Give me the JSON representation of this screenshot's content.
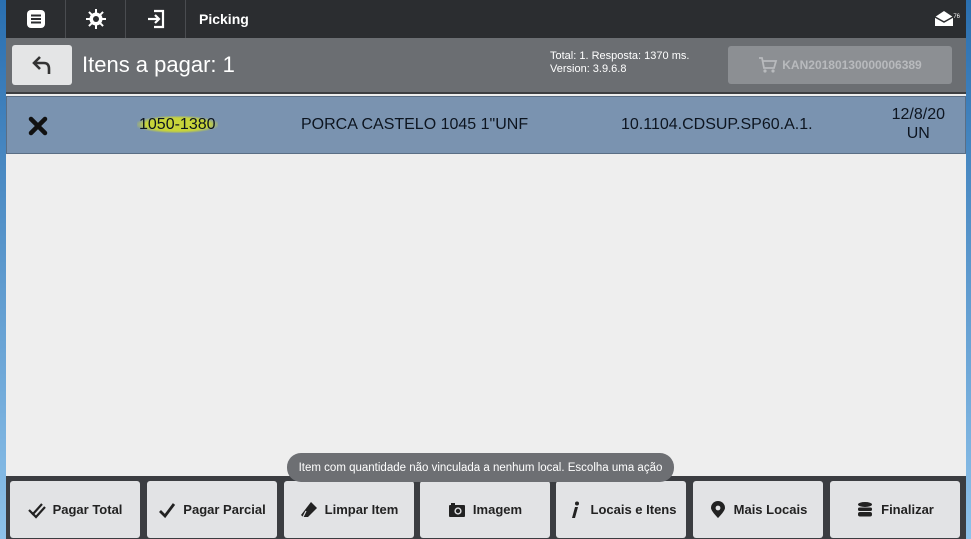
{
  "topbar": {
    "title": "Picking",
    "mail_count": "76",
    "icons": [
      "menu-icon",
      "gear-icon",
      "login-icon",
      "mail-icon"
    ]
  },
  "header": {
    "title": "Itens a pagar: 1",
    "stats_line1": "Total: 1. Resposta: 1370 ms.",
    "stats_line2": "Version: 3.9.6.8",
    "kan_label": "KAN20180130000006389"
  },
  "items": [
    {
      "code": "1050-1380",
      "description": "PORCA CASTELO 1045 1\"UNF",
      "location": "10.1104.CDSUP.SP60.A.1.",
      "quantity": "12/8/20",
      "unit": "UN"
    }
  ],
  "toast": "Item com quantidade não vinculada a nenhum local. Escolha uma ação",
  "actions": {
    "pagar_total": "Pagar Total",
    "pagar_parcial": "Pagar Parcial",
    "limpar_item": "Limpar Item",
    "imagem": "Imagem",
    "locais_itens": "Locais e Itens",
    "mais_locais": "Mais Locais",
    "finalizar": "Finalizar"
  },
  "colors": {
    "selected_row": "#7a93b0",
    "highlight": "#c7d43a",
    "toolbar": "#2b2d30",
    "header": "#6b6e72"
  }
}
